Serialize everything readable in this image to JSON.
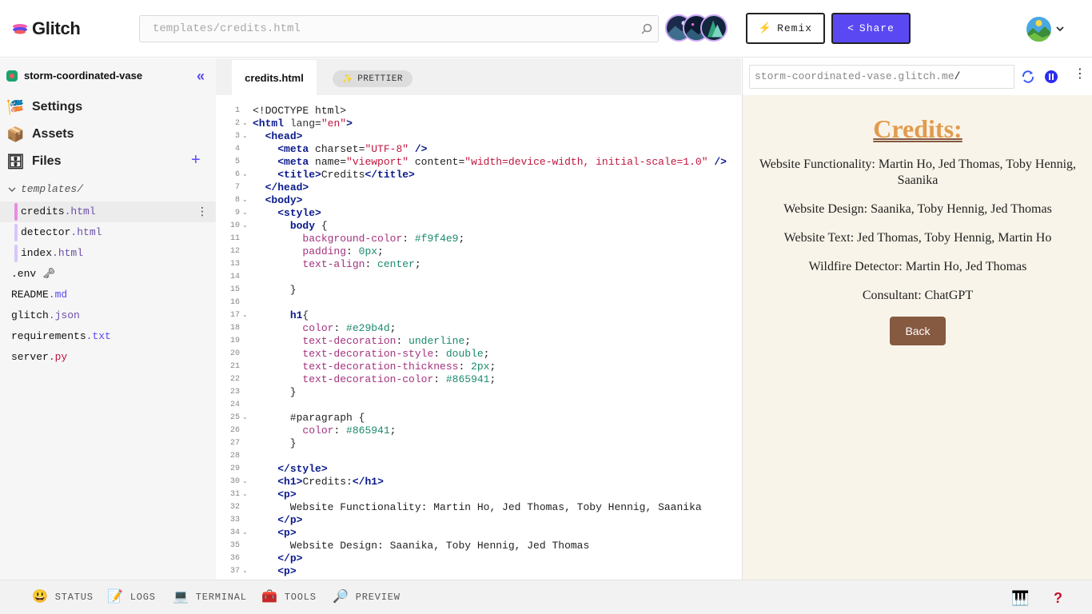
{
  "app": {
    "brand": "Glitch"
  },
  "header": {
    "search_placeholder": "templates/credits.html",
    "remix_label": "Remix",
    "share_label": "Share"
  },
  "sidebar": {
    "project_name": "storm-coordinated-vase",
    "nav": [
      {
        "label": "Settings",
        "icon": "settings-icon"
      },
      {
        "label": "Assets",
        "icon": "assets-box-icon"
      },
      {
        "label": "Files",
        "icon": "files-cabinet-icon"
      }
    ],
    "folder": "templates/",
    "files": [
      {
        "name": "credits",
        "ext": ".html"
      },
      {
        "name": "detector",
        "ext": ".html"
      },
      {
        "name": "index",
        "ext": ".html"
      },
      {
        "name": ".env 🗝",
        "ext": ""
      },
      {
        "name": "README",
        "ext": ".md"
      },
      {
        "name": "glitch",
        "ext": ".json"
      },
      {
        "name": "requirements",
        "ext": ".txt"
      },
      {
        "name": "server",
        "ext": ".py"
      }
    ]
  },
  "editor": {
    "tab": "credits.html",
    "prettier": "PRETTIER"
  },
  "preview": {
    "url": "storm-coordinated-vase.glitch.me",
    "url_suffix": "/",
    "heading": "Credits:",
    "paragraphs": [
      "Website Functionality: Martin Ho, Jed Thomas, Toby Hennig, Saanika",
      "Website Design: Saanika, Toby Hennig, Jed Thomas",
      "Website Text: Jed Thomas, Toby Hennig, Martin Ho",
      "Wildfire Detector: Martin Ho, Jed Thomas",
      "Consultant: ChatGPT"
    ],
    "back_label": "Back"
  },
  "bottom": {
    "items": [
      "STATUS",
      "LOGS",
      "TERMINAL",
      "TOOLS",
      "PREVIEW"
    ]
  },
  "colors": {
    "accent": "#5a49f3",
    "preview_bg": "#f9f4e9",
    "h1_color": "#e29b4d",
    "underline": "#865941"
  }
}
